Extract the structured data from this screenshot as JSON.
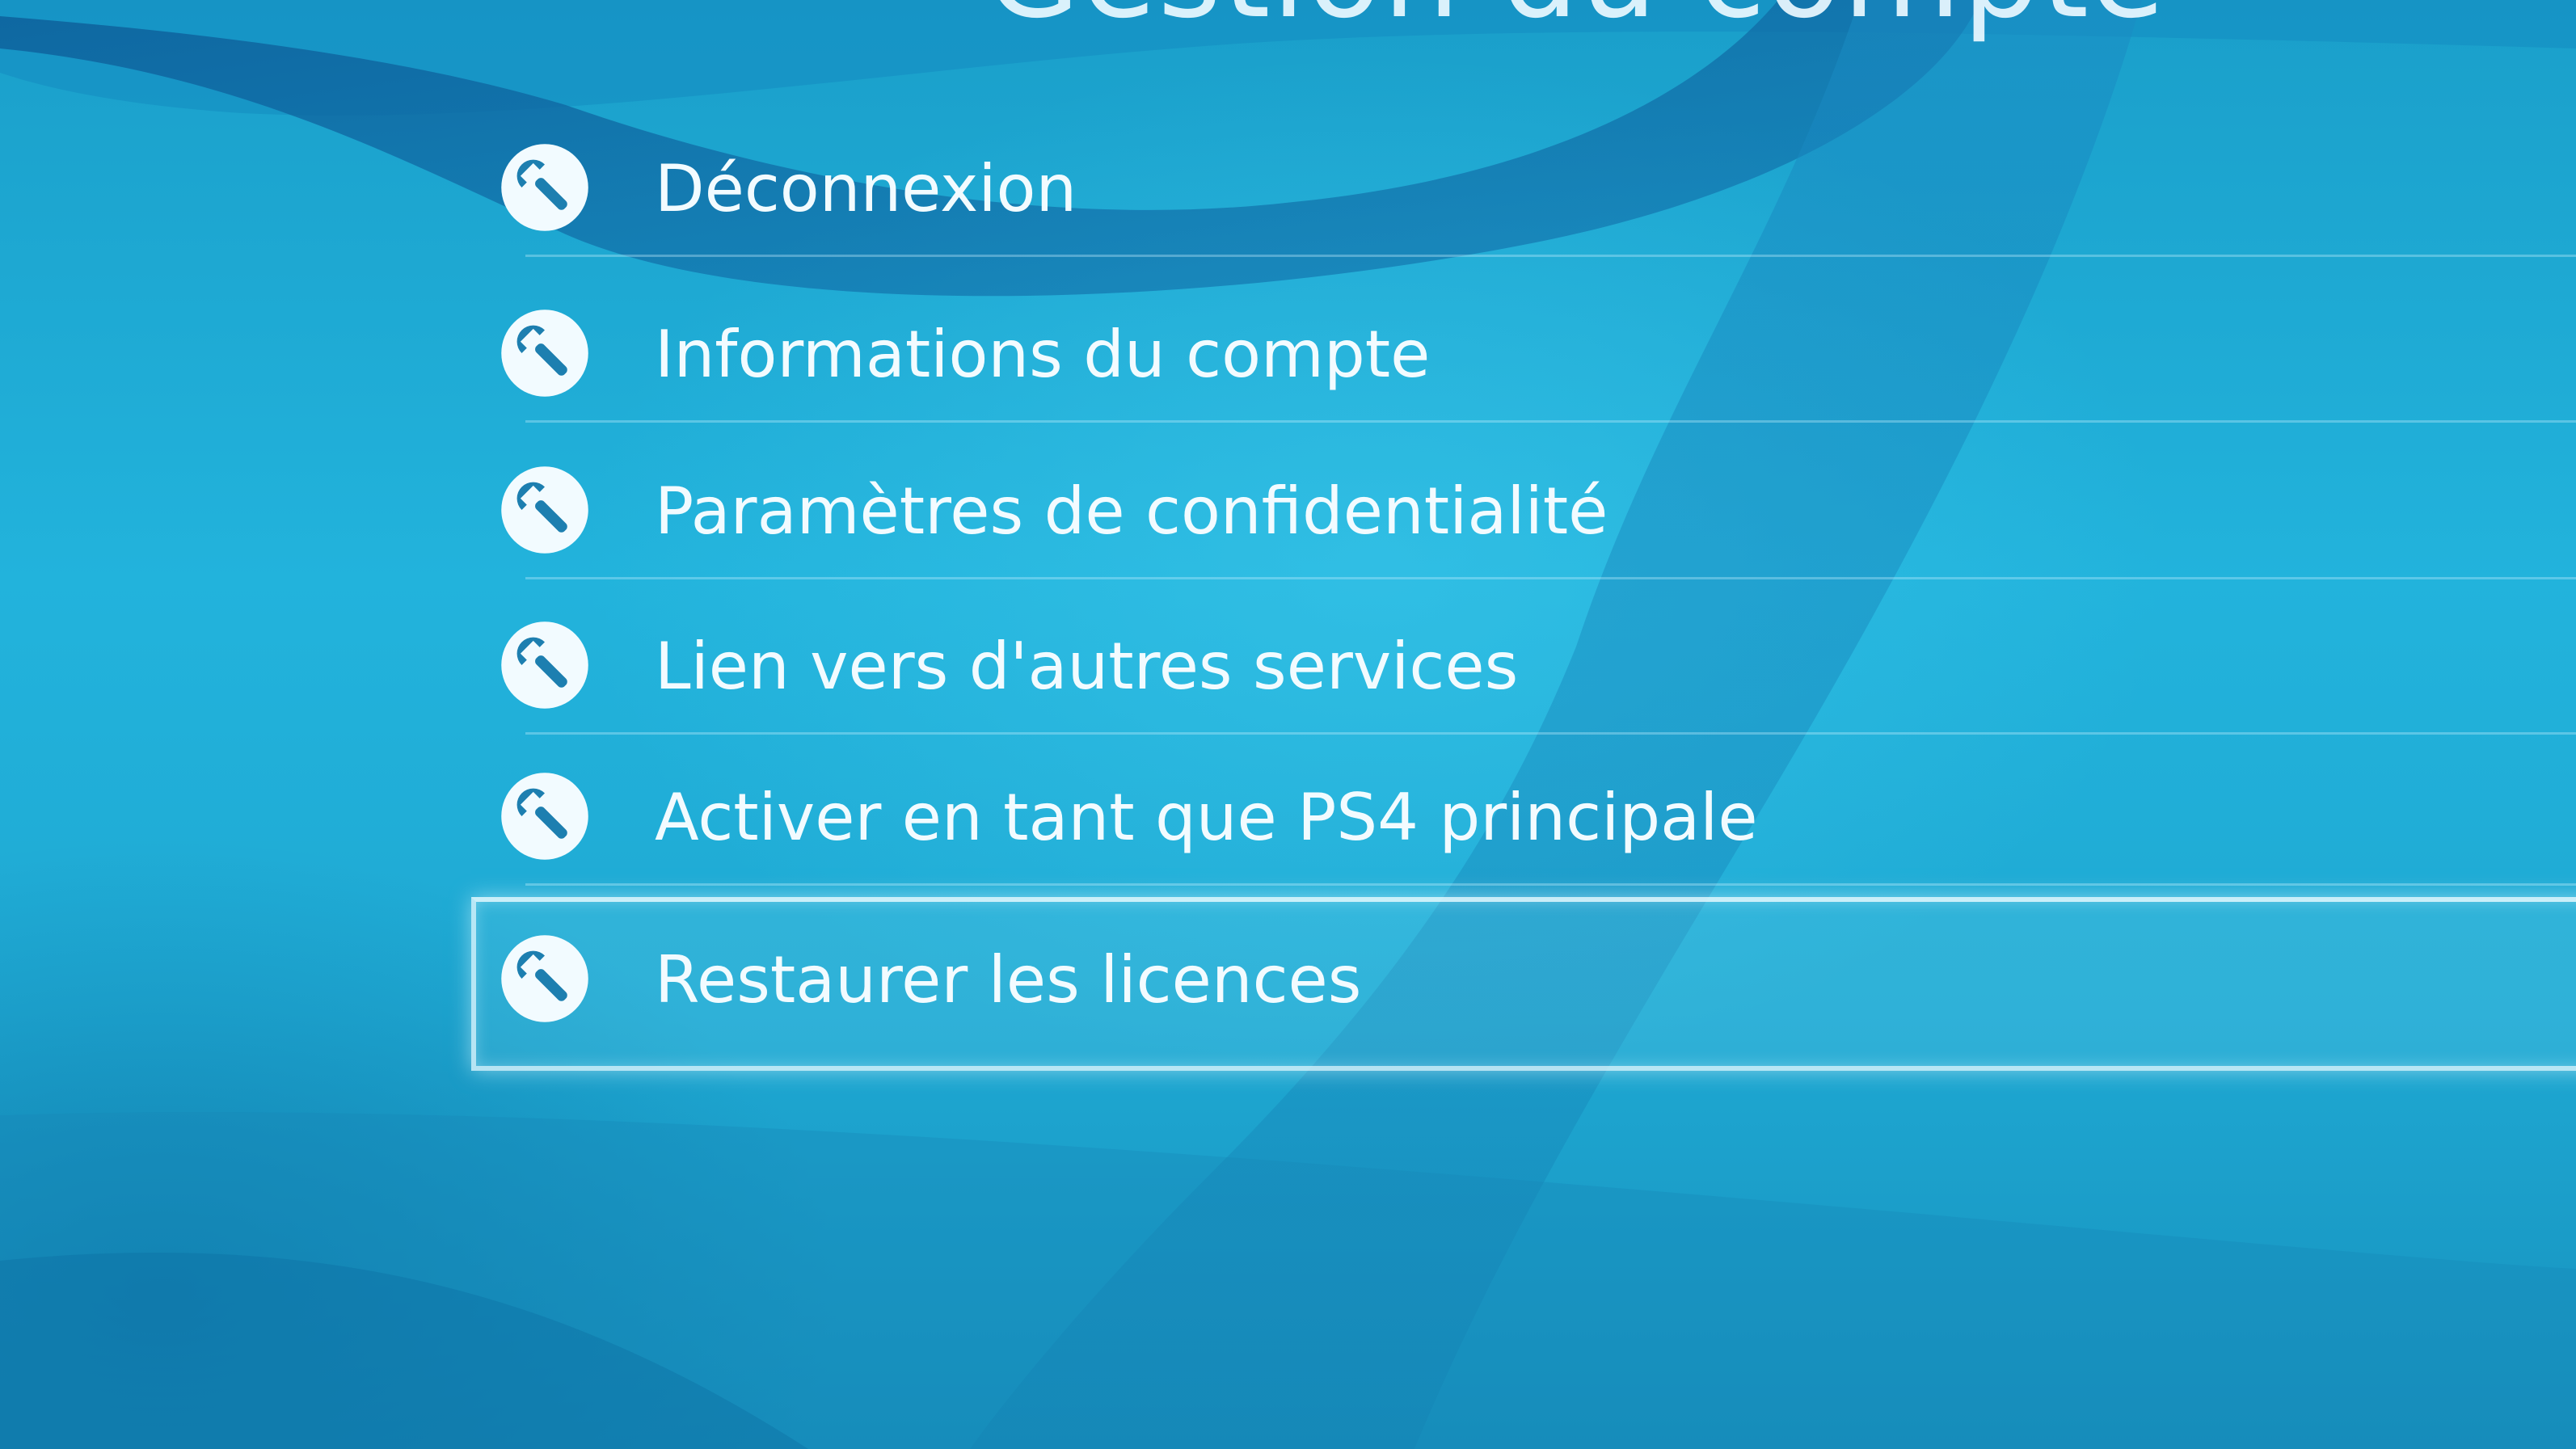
{
  "header": {
    "title": "Gestion du compte"
  },
  "menu": {
    "items": [
      {
        "label": "Déconnexion",
        "icon": "wrench-icon"
      },
      {
        "label": "Informations du compte",
        "icon": "wrench-icon"
      },
      {
        "label": "Paramètres de confidentialité",
        "icon": "wrench-icon"
      },
      {
        "label": "Lien vers d'autres services",
        "icon": "wrench-icon"
      },
      {
        "label": "Activer en tant que PS4 principale",
        "icon": "wrench-icon"
      },
      {
        "label": "Restaurer les licences",
        "icon": "wrench-icon"
      }
    ],
    "selected_label": "Restaurer les licences"
  },
  "colors": {
    "background": "#1ba8cf",
    "text": "#f2fbff",
    "icon_circle": "#f2fbff",
    "icon_glyph": "#1d7fb0"
  }
}
